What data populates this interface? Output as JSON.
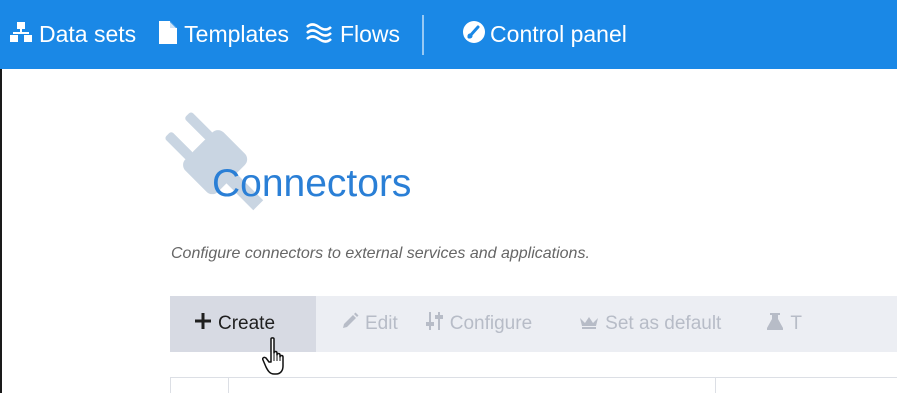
{
  "nav": {
    "items": [
      {
        "id": "datasets",
        "label": "Data sets",
        "icon": "sitemap-icon"
      },
      {
        "id": "templates",
        "label": "Templates",
        "icon": "file-icon"
      },
      {
        "id": "flows",
        "label": "Flows",
        "icon": "approx-wave-icon"
      },
      {
        "id": "control",
        "label": "Control panel",
        "icon": "gauge-icon"
      }
    ],
    "bg_color": "#1a88e6"
  },
  "page": {
    "title": "Connectors",
    "subtitle": "Configure connectors to external services and applications.",
    "header_icon": "plug-icon",
    "title_color": "#2a7fd6"
  },
  "toolbar": {
    "items": [
      {
        "id": "create",
        "label": "Create",
        "icon": "plus-icon",
        "enabled": true
      },
      {
        "id": "edit",
        "label": "Edit",
        "icon": "pencil-icon",
        "enabled": false
      },
      {
        "id": "configure",
        "label": "Configure",
        "icon": "sliders-icon",
        "enabled": false
      },
      {
        "id": "default",
        "label": "Set as default",
        "icon": "crown-icon",
        "enabled": false
      },
      {
        "id": "test",
        "label": "T",
        "icon": "flask-icon",
        "enabled": false
      }
    ]
  }
}
